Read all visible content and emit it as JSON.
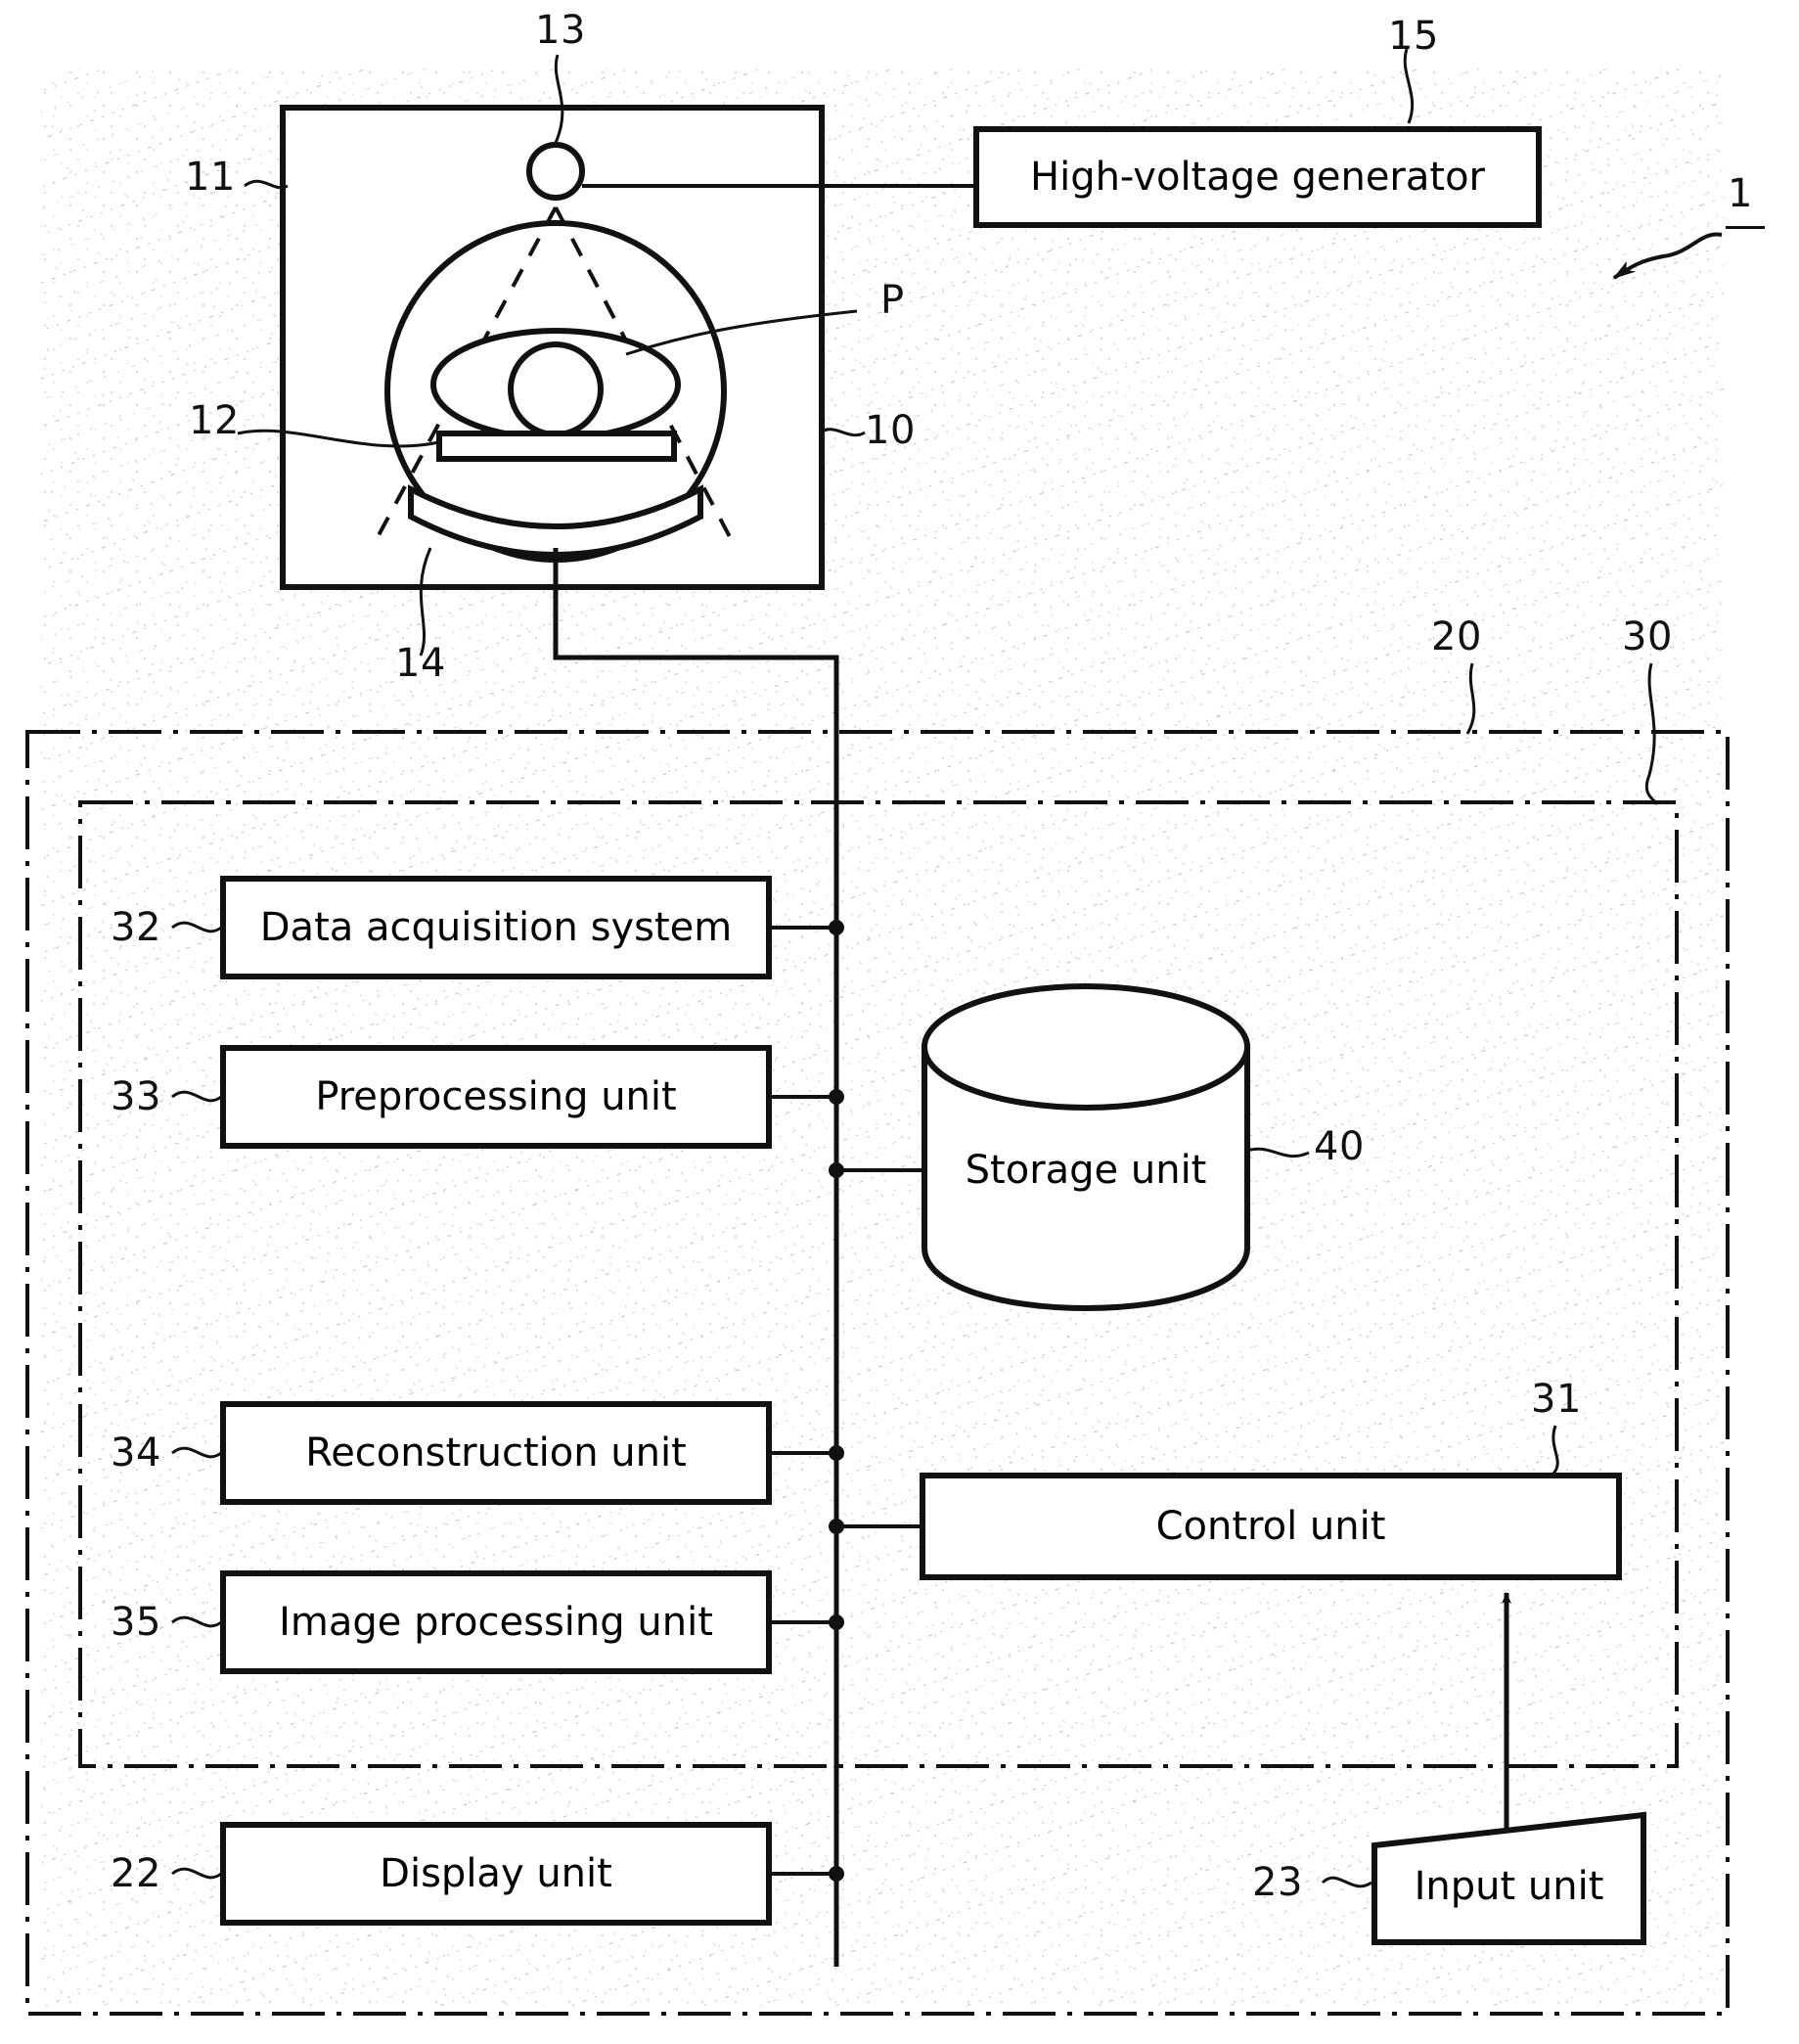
{
  "figure": {
    "kind": "patent-block-diagram",
    "subject": "X-ray CT apparatus block diagram",
    "overall_ref": "1"
  },
  "gantry": {
    "ref": "11",
    "scanner_ref": "10",
    "xray_tube_ref": "13",
    "couch_ref": "12",
    "detector_ref": "14",
    "patient_ref": "P"
  },
  "blocks": {
    "high_voltage_generator": {
      "label": "High-voltage generator",
      "ref": "15"
    },
    "data_acquisition_system": {
      "label": "Data acquisition system",
      "ref": "32"
    },
    "preprocessing_unit": {
      "label": "Preprocessing unit",
      "ref": "33"
    },
    "reconstruction_unit": {
      "label": "Reconstruction unit",
      "ref": "34"
    },
    "image_processing_unit": {
      "label": "Image processing unit",
      "ref": "35"
    },
    "storage_unit": {
      "label": "Storage unit",
      "ref": "40"
    },
    "control_unit": {
      "label": "Control unit",
      "ref": "31"
    },
    "display_unit": {
      "label": "Display unit",
      "ref": "22"
    },
    "input_unit": {
      "label": "Input unit",
      "ref": "23"
    }
  },
  "regions": {
    "console": {
      "ref": "20"
    },
    "processing_group": {
      "ref": "30"
    }
  },
  "colors": {
    "ink": "#111111",
    "paper": "#ffffff",
    "hatch": "#7b7b7b"
  }
}
